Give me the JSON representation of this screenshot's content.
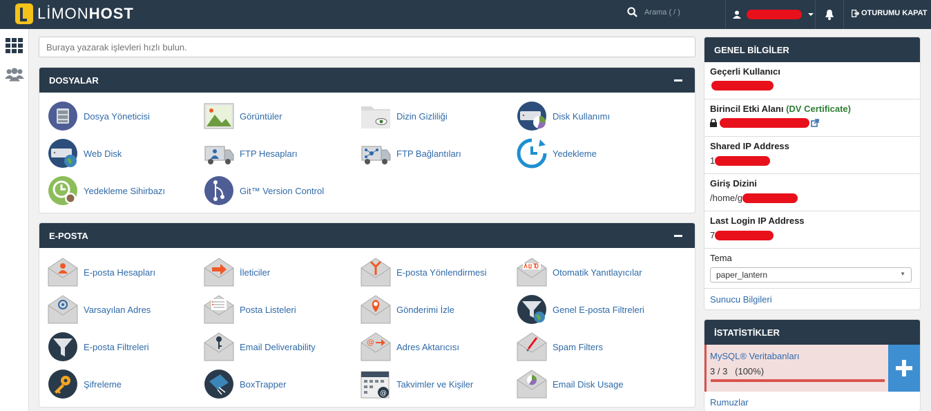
{
  "topbar": {
    "brand_light": "LİMON",
    "brand_bold": "HOST",
    "search_hint": "Arama ( / )",
    "logout": "OTURUMU KAPAT"
  },
  "quick_search": {
    "placeholder": "Buraya yazarak işlevleri hızlı bulun."
  },
  "files": {
    "title": "DOSYALAR",
    "items": [
      {
        "label": "Dosya Yöneticisi",
        "icon": "file-manager-icon"
      },
      {
        "label": "Görüntüler",
        "icon": "images-icon"
      },
      {
        "label": "Dizin Gizliliği",
        "icon": "directory-privacy-icon"
      },
      {
        "label": "Disk Kullanımı",
        "icon": "disk-usage-icon"
      },
      {
        "label": "Web Disk",
        "icon": "web-disk-icon"
      },
      {
        "label": "FTP Hesapları",
        "icon": "ftp-accounts-icon"
      },
      {
        "label": "FTP Bağlantıları",
        "icon": "ftp-connections-icon"
      },
      {
        "label": "Yedekleme",
        "icon": "backup-icon"
      },
      {
        "label": "Yedekleme Sihirbazı",
        "icon": "backup-wizard-icon"
      },
      {
        "label": "Git™ Version Control",
        "icon": "git-icon"
      }
    ]
  },
  "email": {
    "title": "E-POSTA",
    "items": [
      {
        "label": "E-posta Hesapları",
        "icon": "email-accounts-icon"
      },
      {
        "label": "İleticiler",
        "icon": "forwarders-icon"
      },
      {
        "label": "E-posta Yönlendirmesi",
        "icon": "email-routing-icon"
      },
      {
        "label": "Otomatik Yanıtlayıcılar",
        "icon": "autoresponders-icon"
      },
      {
        "label": "Varsayılan Adres",
        "icon": "default-address-icon"
      },
      {
        "label": "Posta Listeleri",
        "icon": "mailing-lists-icon"
      },
      {
        "label": "Gönderimi İzle",
        "icon": "track-delivery-icon"
      },
      {
        "label": "Genel E-posta Filtreleri",
        "icon": "global-filters-icon"
      },
      {
        "label": "E-posta Filtreleri",
        "icon": "email-filters-icon"
      },
      {
        "label": "Email Deliverability",
        "icon": "deliverability-icon"
      },
      {
        "label": "Adres Aktarıcısı",
        "icon": "address-importer-icon"
      },
      {
        "label": "Spam Filters",
        "icon": "spam-filters-icon"
      },
      {
        "label": "Şifreleme",
        "icon": "encryption-icon"
      },
      {
        "label": "BoxTrapper",
        "icon": "boxtrapper-icon"
      },
      {
        "label": "Takvimler ve Kişiler",
        "icon": "calendars-icon"
      },
      {
        "label": "Email Disk Usage",
        "icon": "email-disk-usage-icon"
      }
    ]
  },
  "general": {
    "title": "GENEL BİLGİLER",
    "current_user": "Geçerli Kullanıcı",
    "primary_domain": "Birincil Etki Alanı",
    "dv_open": "(",
    "dv_text": "DV Certificate",
    "dv_close": ")",
    "shared_ip": "Shared IP Address",
    "shared_ip_prefix": "1",
    "home_dir": "Giriş Dizini",
    "home_dir_prefix": "/home/g",
    "last_login": "Last Login IP Address",
    "last_login_prefix": "7",
    "theme": "Tema",
    "theme_value": "paper_lantern",
    "server_info": "Sunucu Bilgileri"
  },
  "stats": {
    "title": "İSTATİSTİKLER",
    "mysql": "MySQL® Veritabanları",
    "mysql_value": "3 / 3   (100%)",
    "mysql_fraction": 1.0,
    "aliases": "Rumuzlar"
  }
}
